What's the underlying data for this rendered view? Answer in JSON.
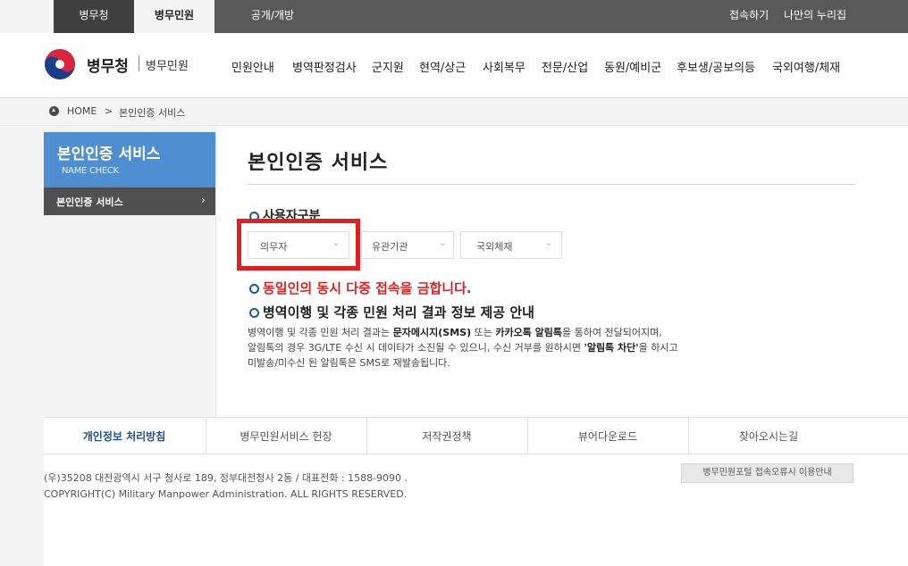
{
  "topbar": {
    "tabs": [
      "병무청",
      "병무민원",
      "공개/개방"
    ],
    "links": [
      "접속하기",
      "나만의 누리집"
    ]
  },
  "header": {
    "logo_main": "병무청",
    "logo_sub": "병무민원",
    "menu": [
      "민원안내",
      "병역판정검사",
      "군지원",
      "현역/상근",
      "사회복무",
      "전문/산업",
      "동원/예비군",
      "후보생/공보의등",
      "국외여행/체재"
    ]
  },
  "breadcrumb": {
    "home": "HOME",
    "sep": ">",
    "current": "본인인증 서비스"
  },
  "sidebar": {
    "title": "본인인증 서비스",
    "subtitle": "NAME CHECK",
    "items": [
      {
        "label": "본인인증 서비스",
        "chevron": "›"
      }
    ]
  },
  "main": {
    "title": "본인인증 서비스",
    "user_type_label": "사용자구분",
    "selects": [
      {
        "label": "의무자"
      },
      {
        "label": "유관기관"
      },
      {
        "label": "국외체재"
      }
    ],
    "warning": "동일인의 동시 다중 접속을 금합니다.",
    "notice_title": "병역이행 및 각종 민원 처리 결과 정보 제공 안내",
    "notice_lines": [
      [
        "병역이행 및 각종 민원 처리 결과는 ",
        "문자메시지(SMS)",
        " 또는 ",
        "카카오톡 알림톡",
        "을 통하여 전달되어지며,"
      ],
      [
        "알림톡의 경우 3G/LTE 수신 시 데이타가 소진될 수 있으니, 수신 거부를 원하시면 ",
        "'알림톡 차단'",
        "을 하시고"
      ],
      [
        "미발송/미수신 된 알림톡은 SMS로 재발송됩니다."
      ]
    ]
  },
  "footer": {
    "links": [
      "개인정보 처리방침",
      "병무민원서비스 헌장",
      "저작권정책",
      "뷰어다운로드",
      "찾아오시는길"
    ],
    "address": "(우)35208 대전광역시 서구 청사로 189, 정부대전청사 2동 / 대표전화 : 1588-9090 .",
    "copyright": "COPYRIGHT(C) Military Manpower Administration. ALL RIGHTS RESERVED.",
    "error_button": "병무민원포털 접속오류시 이용안내"
  },
  "colors": {
    "accent_blue": "#4f8fd1",
    "warn_red": "#e02020",
    "dark_gray": "#595959"
  }
}
